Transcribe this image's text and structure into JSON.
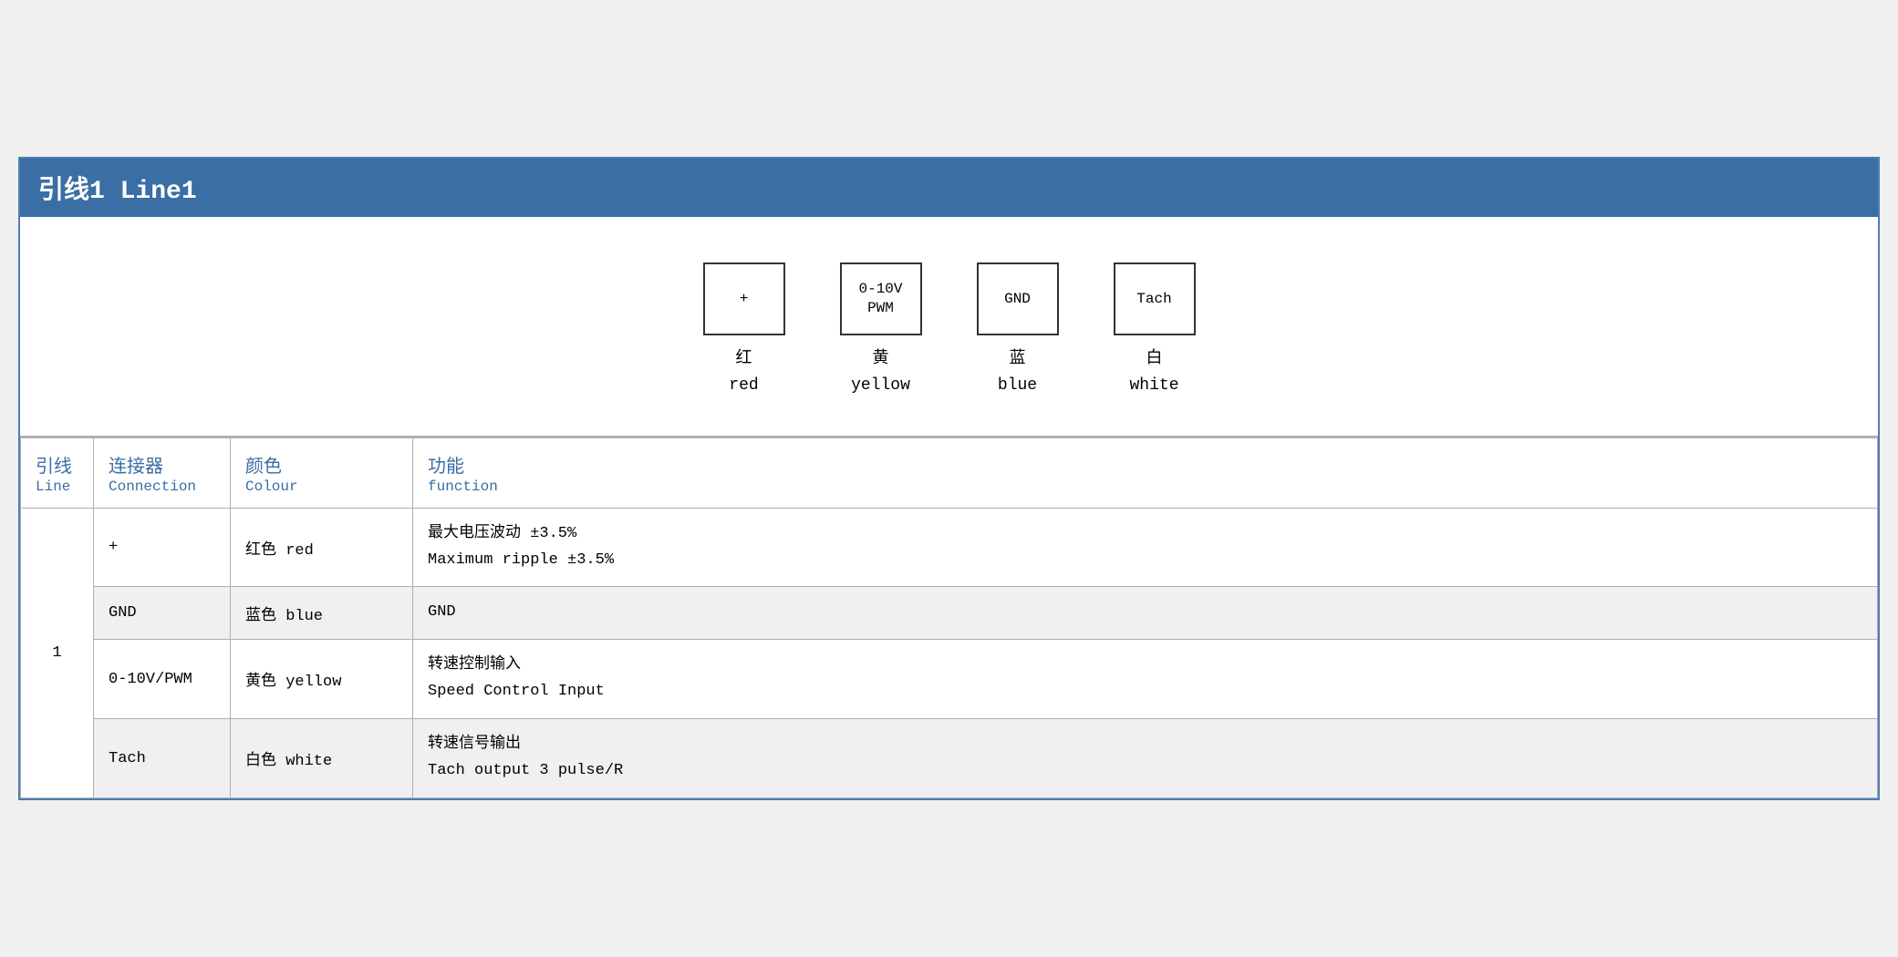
{
  "title": "引线1 Line1",
  "diagram": {
    "connectors": [
      {
        "id": "plus",
        "symbol": "+",
        "chinese": "红",
        "english": "red"
      },
      {
        "id": "pwm",
        "symbol": "0-10V\nPWM",
        "chinese": "黄",
        "english": "yellow"
      },
      {
        "id": "gnd",
        "symbol": "GND",
        "chinese": "蓝",
        "english": "blue"
      },
      {
        "id": "tach",
        "symbol": "Tach",
        "chinese": "白",
        "english": "white"
      }
    ]
  },
  "table": {
    "headers": {
      "line_chinese": "引线",
      "line_english": "Line",
      "connection_chinese": "连接器",
      "connection_english": "Connection",
      "colour_chinese": "颜色",
      "colour_english": "Colour",
      "function_chinese": "功能",
      "function_english": "function"
    },
    "rows": [
      {
        "line": "1",
        "connection": "+",
        "colour": "红色 red",
        "function_chinese": "最大电压波动 ±3.5%",
        "function_english": "Maximum ripple ±3.5%",
        "shaded": false
      },
      {
        "line": "",
        "connection": "GND",
        "colour": "蓝色 blue",
        "function_chinese": "GND",
        "function_english": "",
        "shaded": true
      },
      {
        "line": "",
        "connection": "0-10V/PWM",
        "colour": "黄色 yellow",
        "function_chinese": "转速控制输入",
        "function_english": "Speed Control Input",
        "shaded": false
      },
      {
        "line": "",
        "connection": "Tach",
        "colour": "白色 white",
        "function_chinese": "转速信号输出",
        "function_english": "Tach output 3 pulse/R",
        "shaded": true
      }
    ]
  }
}
